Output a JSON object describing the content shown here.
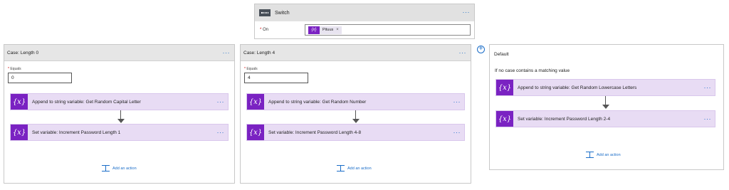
{
  "switch": {
    "title": "Switch",
    "menu": "···",
    "on_label": "On",
    "token_icon": "{x}",
    "token_text": "Pituus",
    "token_remove": "×"
  },
  "cases": [
    {
      "title": "Case: Length 0",
      "menu": "···",
      "equals_label": "Equals",
      "equals_value": "0",
      "actions": [
        {
          "icon": "{x}",
          "text": "Append to string variable: Get Random Capital Letter",
          "menu": "···"
        },
        {
          "icon": "{x}",
          "text": "Set variable: Increment Password Length 1",
          "menu": "···"
        }
      ],
      "add_action": "Add an action"
    },
    {
      "title": "Case: Length 4",
      "menu": "···",
      "equals_label": "Equals",
      "equals_value": "4",
      "actions": [
        {
          "icon": "{x}",
          "text": "Append to string variable: Get Random Number",
          "menu": "···"
        },
        {
          "icon": "{x}",
          "text": "Set variable: Increment Password Length 4-8",
          "menu": "···"
        }
      ],
      "add_action": "Add an action"
    }
  ],
  "add_case_icon": "+",
  "default": {
    "title": "Default",
    "description": "If no case contains a matching value",
    "actions": [
      {
        "icon": "{x}",
        "text": "Append to string variable: Get Random Lowercase Letters",
        "menu": "···"
      },
      {
        "icon": "{x}",
        "text": "Set variable: Increment Password Length 2-4",
        "menu": "···"
      }
    ],
    "add_action": "Add an action"
  },
  "colors": {
    "accent": "#1a6dc8",
    "variable_icon": "#7a22c2",
    "action_bg": "#e8dcf4",
    "header_bg": "#e6e6e6"
  }
}
